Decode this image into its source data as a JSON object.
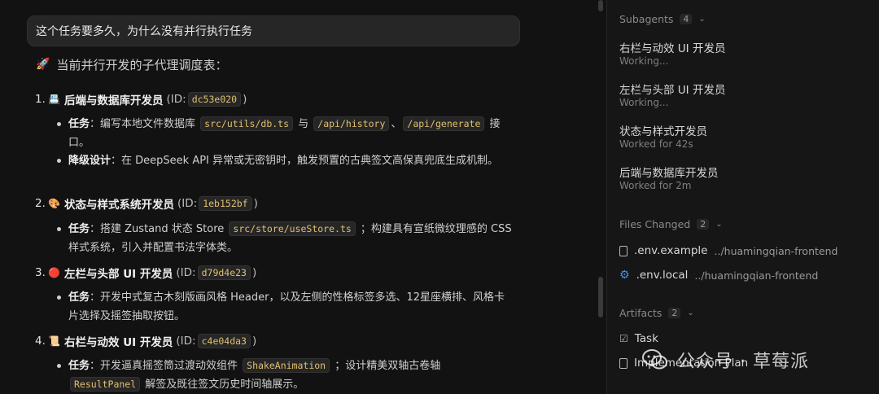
{
  "user_message": "这个任务要多久，为什么没有并行执行任务",
  "intro": {
    "emoji": "🚀",
    "text": "当前并行开发的子代理调度表："
  },
  "agents_list": [
    {
      "num": "1.",
      "emoji": "📇",
      "name": "后端与数据库开发员",
      "id_prefix": "(ID:",
      "id": "dc53e020",
      "id_suffix": ")",
      "bullets": [
        {
          "label": "任务",
          "parts": [
            "：编写本地文件数据库 ",
            {
              "code": "src/utils/db.ts"
            },
            " 与 ",
            {
              "code": "/api/history"
            },
            "、",
            {
              "code": "/api/generate"
            },
            " 接口。"
          ]
        },
        {
          "label": "降级设计",
          "parts": [
            "：在 DeepSeek API 异常或无密钥时，触发预置的古典签文高保真兜底生成机制。"
          ]
        }
      ]
    },
    {
      "num": "2.",
      "emoji": "🎨",
      "name": "状态与样式系统开发员",
      "id_prefix": "(ID:",
      "id": "1eb152bf",
      "id_suffix": ")",
      "bullets": [
        {
          "label": "任务",
          "parts": [
            "：搭建 Zustand 状态 Store ",
            {
              "code": "src/store/useStore.ts"
            },
            " ；构建具有宣纸微纹理感的 CSS 样式系统，引入并配置书法字体类。"
          ]
        }
      ]
    },
    {
      "num": "3.",
      "emoji": "🔴",
      "name": "左栏与头部 UI 开发员",
      "id_prefix": "(ID:",
      "id": "d79d4e23",
      "id_suffix": ")",
      "bullets": [
        {
          "label": "任务",
          "parts": [
            "：开发中式复古木刻版画风格 Header，以及左侧的性格标签多选、12星座横排、风格卡片选择及摇签抽取按钮。"
          ]
        }
      ]
    },
    {
      "num": "4.",
      "emoji": "📜",
      "name": "右栏与动效 UI 开发员",
      "id_prefix": "(ID:",
      "id": "c4e04da3",
      "id_suffix": ")",
      "bullets": [
        {
          "label": "任务",
          "parts": [
            "：开发逼真摇签筒过渡动效组件 ",
            {
              "code": "ShakeAnimation"
            },
            " ；设计精美双轴古卷轴 ",
            {
              "code": "ResultPanel"
            },
            " 解签及既往签文历史时间轴展示。"
          ]
        }
      ]
    }
  ],
  "sidebar": {
    "subagents": {
      "title": "Subagents",
      "count": "4",
      "items": [
        {
          "name": "右栏与动效 UI 开发员",
          "status": "Working..."
        },
        {
          "name": "左栏与头部 UI 开发员",
          "status": "Working..."
        },
        {
          "name": "状态与样式开发员",
          "status": "Worked for 42s"
        },
        {
          "name": "后端与数据库开发员",
          "status": "Worked for 2m"
        }
      ]
    },
    "files_changed": {
      "title": "Files Changed",
      "count": "2",
      "items": [
        {
          "icon": "document-icon",
          "name": ".env.example",
          "path": "../huamingqian-frontend"
        },
        {
          "icon": "gear-icon",
          "name": ".env.local",
          "path": "../huamingqian-frontend"
        }
      ]
    },
    "artifacts": {
      "title": "Artifacts",
      "count": "2",
      "items": [
        {
          "icon": "checklist-icon",
          "name": "Task"
        },
        {
          "icon": "document-icon",
          "name": "Implementation Plan"
        }
      ]
    }
  },
  "watermark": {
    "text": "公众号 · 草莓派"
  },
  "colors": {
    "background": "#121212",
    "sidebar": "#161616",
    "code": "#e0c070",
    "gear": "#4a90d9"
  }
}
